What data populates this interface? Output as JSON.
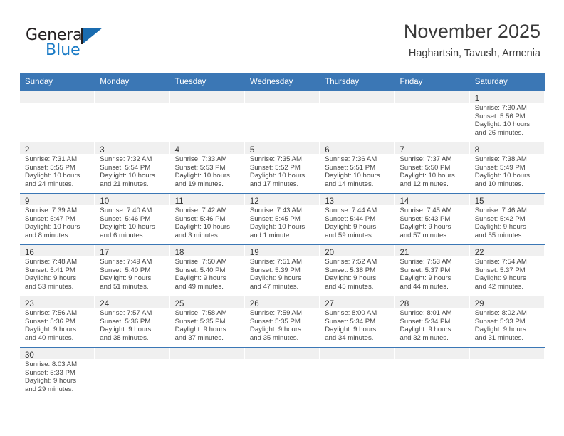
{
  "brand": {
    "name_part1": "General",
    "name_part2": "Blue",
    "logo_icon": "flag-triangle-icon",
    "accent_color": "#1a7bc6"
  },
  "header": {
    "title": "November 2025",
    "subtitle": "Haghartsin, Tavush, Armenia"
  },
  "colors": {
    "header_blue": "#3b77b5",
    "daynum_band": "#f0f0f0",
    "text": "#444444"
  },
  "calendar": {
    "weekday_headers": [
      "Sunday",
      "Monday",
      "Tuesday",
      "Wednesday",
      "Thursday",
      "Friday",
      "Saturday"
    ],
    "weeks": [
      [
        {
          "day": "",
          "sunrise": "",
          "sunset": "",
          "daylight1": "",
          "daylight2": "",
          "empty": true
        },
        {
          "day": "",
          "sunrise": "",
          "sunset": "",
          "daylight1": "",
          "daylight2": "",
          "empty": true
        },
        {
          "day": "",
          "sunrise": "",
          "sunset": "",
          "daylight1": "",
          "daylight2": "",
          "empty": true
        },
        {
          "day": "",
          "sunrise": "",
          "sunset": "",
          "daylight1": "",
          "daylight2": "",
          "empty": true
        },
        {
          "day": "",
          "sunrise": "",
          "sunset": "",
          "daylight1": "",
          "daylight2": "",
          "empty": true
        },
        {
          "day": "",
          "sunrise": "",
          "sunset": "",
          "daylight1": "",
          "daylight2": "",
          "empty": true
        },
        {
          "day": "1",
          "sunrise": "Sunrise: 7:30 AM",
          "sunset": "Sunset: 5:56 PM",
          "daylight1": "Daylight: 10 hours",
          "daylight2": "and 26 minutes.",
          "empty": false
        }
      ],
      [
        {
          "day": "2",
          "sunrise": "Sunrise: 7:31 AM",
          "sunset": "Sunset: 5:55 PM",
          "daylight1": "Daylight: 10 hours",
          "daylight2": "and 24 minutes.",
          "empty": false
        },
        {
          "day": "3",
          "sunrise": "Sunrise: 7:32 AM",
          "sunset": "Sunset: 5:54 PM",
          "daylight1": "Daylight: 10 hours",
          "daylight2": "and 21 minutes.",
          "empty": false
        },
        {
          "day": "4",
          "sunrise": "Sunrise: 7:33 AM",
          "sunset": "Sunset: 5:53 PM",
          "daylight1": "Daylight: 10 hours",
          "daylight2": "and 19 minutes.",
          "empty": false
        },
        {
          "day": "5",
          "sunrise": "Sunrise: 7:35 AM",
          "sunset": "Sunset: 5:52 PM",
          "daylight1": "Daylight: 10 hours",
          "daylight2": "and 17 minutes.",
          "empty": false
        },
        {
          "day": "6",
          "sunrise": "Sunrise: 7:36 AM",
          "sunset": "Sunset: 5:51 PM",
          "daylight1": "Daylight: 10 hours",
          "daylight2": "and 14 minutes.",
          "empty": false
        },
        {
          "day": "7",
          "sunrise": "Sunrise: 7:37 AM",
          "sunset": "Sunset: 5:50 PM",
          "daylight1": "Daylight: 10 hours",
          "daylight2": "and 12 minutes.",
          "empty": false
        },
        {
          "day": "8",
          "sunrise": "Sunrise: 7:38 AM",
          "sunset": "Sunset: 5:49 PM",
          "daylight1": "Daylight: 10 hours",
          "daylight2": "and 10 minutes.",
          "empty": false
        }
      ],
      [
        {
          "day": "9",
          "sunrise": "Sunrise: 7:39 AM",
          "sunset": "Sunset: 5:47 PM",
          "daylight1": "Daylight: 10 hours",
          "daylight2": "and 8 minutes.",
          "empty": false
        },
        {
          "day": "10",
          "sunrise": "Sunrise: 7:40 AM",
          "sunset": "Sunset: 5:46 PM",
          "daylight1": "Daylight: 10 hours",
          "daylight2": "and 6 minutes.",
          "empty": false
        },
        {
          "day": "11",
          "sunrise": "Sunrise: 7:42 AM",
          "sunset": "Sunset: 5:46 PM",
          "daylight1": "Daylight: 10 hours",
          "daylight2": "and 3 minutes.",
          "empty": false
        },
        {
          "day": "12",
          "sunrise": "Sunrise: 7:43 AM",
          "sunset": "Sunset: 5:45 PM",
          "daylight1": "Daylight: 10 hours",
          "daylight2": "and 1 minute.",
          "empty": false
        },
        {
          "day": "13",
          "sunrise": "Sunrise: 7:44 AM",
          "sunset": "Sunset: 5:44 PM",
          "daylight1": "Daylight: 9 hours",
          "daylight2": "and 59 minutes.",
          "empty": false
        },
        {
          "day": "14",
          "sunrise": "Sunrise: 7:45 AM",
          "sunset": "Sunset: 5:43 PM",
          "daylight1": "Daylight: 9 hours",
          "daylight2": "and 57 minutes.",
          "empty": false
        },
        {
          "day": "15",
          "sunrise": "Sunrise: 7:46 AM",
          "sunset": "Sunset: 5:42 PM",
          "daylight1": "Daylight: 9 hours",
          "daylight2": "and 55 minutes.",
          "empty": false
        }
      ],
      [
        {
          "day": "16",
          "sunrise": "Sunrise: 7:48 AM",
          "sunset": "Sunset: 5:41 PM",
          "daylight1": "Daylight: 9 hours",
          "daylight2": "and 53 minutes.",
          "empty": false
        },
        {
          "day": "17",
          "sunrise": "Sunrise: 7:49 AM",
          "sunset": "Sunset: 5:40 PM",
          "daylight1": "Daylight: 9 hours",
          "daylight2": "and 51 minutes.",
          "empty": false
        },
        {
          "day": "18",
          "sunrise": "Sunrise: 7:50 AM",
          "sunset": "Sunset: 5:40 PM",
          "daylight1": "Daylight: 9 hours",
          "daylight2": "and 49 minutes.",
          "empty": false
        },
        {
          "day": "19",
          "sunrise": "Sunrise: 7:51 AM",
          "sunset": "Sunset: 5:39 PM",
          "daylight1": "Daylight: 9 hours",
          "daylight2": "and 47 minutes.",
          "empty": false
        },
        {
          "day": "20",
          "sunrise": "Sunrise: 7:52 AM",
          "sunset": "Sunset: 5:38 PM",
          "daylight1": "Daylight: 9 hours",
          "daylight2": "and 45 minutes.",
          "empty": false
        },
        {
          "day": "21",
          "sunrise": "Sunrise: 7:53 AM",
          "sunset": "Sunset: 5:37 PM",
          "daylight1": "Daylight: 9 hours",
          "daylight2": "and 44 minutes.",
          "empty": false
        },
        {
          "day": "22",
          "sunrise": "Sunrise: 7:54 AM",
          "sunset": "Sunset: 5:37 PM",
          "daylight1": "Daylight: 9 hours",
          "daylight2": "and 42 minutes.",
          "empty": false
        }
      ],
      [
        {
          "day": "23",
          "sunrise": "Sunrise: 7:56 AM",
          "sunset": "Sunset: 5:36 PM",
          "daylight1": "Daylight: 9 hours",
          "daylight2": "and 40 minutes.",
          "empty": false
        },
        {
          "day": "24",
          "sunrise": "Sunrise: 7:57 AM",
          "sunset": "Sunset: 5:36 PM",
          "daylight1": "Daylight: 9 hours",
          "daylight2": "and 38 minutes.",
          "empty": false
        },
        {
          "day": "25",
          "sunrise": "Sunrise: 7:58 AM",
          "sunset": "Sunset: 5:35 PM",
          "daylight1": "Daylight: 9 hours",
          "daylight2": "and 37 minutes.",
          "empty": false
        },
        {
          "day": "26",
          "sunrise": "Sunrise: 7:59 AM",
          "sunset": "Sunset: 5:35 PM",
          "daylight1": "Daylight: 9 hours",
          "daylight2": "and 35 minutes.",
          "empty": false
        },
        {
          "day": "27",
          "sunrise": "Sunrise: 8:00 AM",
          "sunset": "Sunset: 5:34 PM",
          "daylight1": "Daylight: 9 hours",
          "daylight2": "and 34 minutes.",
          "empty": false
        },
        {
          "day": "28",
          "sunrise": "Sunrise: 8:01 AM",
          "sunset": "Sunset: 5:34 PM",
          "daylight1": "Daylight: 9 hours",
          "daylight2": "and 32 minutes.",
          "empty": false
        },
        {
          "day": "29",
          "sunrise": "Sunrise: 8:02 AM",
          "sunset": "Sunset: 5:33 PM",
          "daylight1": "Daylight: 9 hours",
          "daylight2": "and 31 minutes.",
          "empty": false
        }
      ],
      [
        {
          "day": "30",
          "sunrise": "Sunrise: 8:03 AM",
          "sunset": "Sunset: 5:33 PM",
          "daylight1": "Daylight: 9 hours",
          "daylight2": "and 29 minutes.",
          "empty": false
        },
        {
          "day": "",
          "sunrise": "",
          "sunset": "",
          "daylight1": "",
          "daylight2": "",
          "empty": true
        },
        {
          "day": "",
          "sunrise": "",
          "sunset": "",
          "daylight1": "",
          "daylight2": "",
          "empty": true
        },
        {
          "day": "",
          "sunrise": "",
          "sunset": "",
          "daylight1": "",
          "daylight2": "",
          "empty": true
        },
        {
          "day": "",
          "sunrise": "",
          "sunset": "",
          "daylight1": "",
          "daylight2": "",
          "empty": true
        },
        {
          "day": "",
          "sunrise": "",
          "sunset": "",
          "daylight1": "",
          "daylight2": "",
          "empty": true
        },
        {
          "day": "",
          "sunrise": "",
          "sunset": "",
          "daylight1": "",
          "daylight2": "",
          "empty": true
        }
      ]
    ]
  }
}
